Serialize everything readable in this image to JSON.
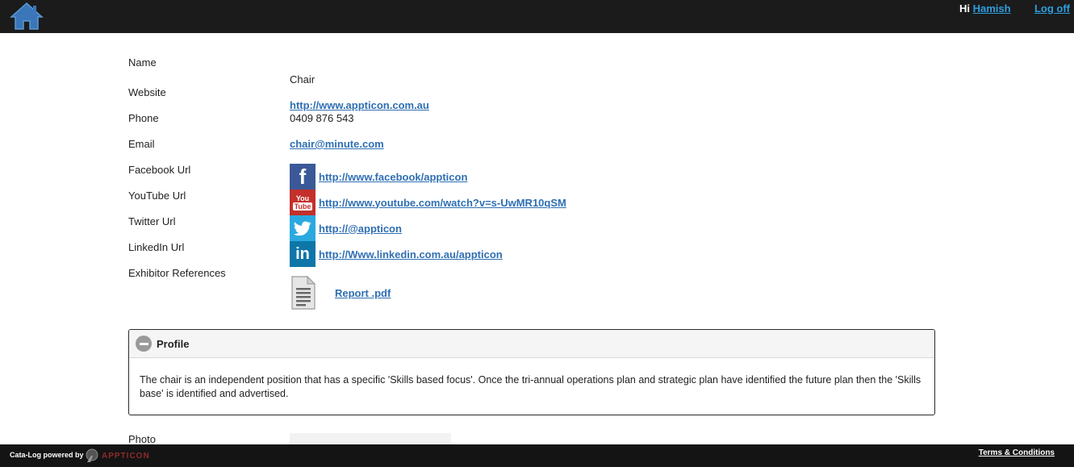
{
  "header": {
    "greeting": "Hi",
    "username": "Hamish",
    "logoff_label": "Log off"
  },
  "fields": {
    "name_label": "Name",
    "name_value": "Chair",
    "website_label": "Website",
    "website_value": "http://www.appticon.com.au",
    "phone_label": "Phone",
    "phone_value": "0409 876 543",
    "email_label": "Email",
    "email_value": "chair@minute.com",
    "facebook_label": "Facebook Url",
    "facebook_value": "http://www.facebook/appticon",
    "youtube_label": "YouTube Url",
    "youtube_value": "http://www.youtube.com/watch?v=s-UwMR10qSM",
    "twitter_label": "Twitter Url",
    "twitter_value": "http://@appticon",
    "linkedin_label": "LinkedIn Url",
    "linkedin_value": "http://Www.linkedin.com.au/appticon",
    "references_label": "Exhibitor References",
    "reference_file": "Report .pdf",
    "photo_label": "Photo"
  },
  "icons": {
    "facebook": "f",
    "youtube": "You Tube",
    "twitter": "twitter-bird-icon",
    "linkedin": "in"
  },
  "profile": {
    "title": "Profile",
    "text": "The chair is an independent position that has a specific 'Skills based focus'. Once the tri-annual operations plan and strategic plan have identified the future plan then the 'Skills base' is identified and advertised."
  },
  "footer": {
    "powered_by": "Cata-Log powered by",
    "brand": "APPTICON",
    "terms_label": "Terms & Conditions"
  },
  "colors": {
    "facebook": "#3b5998",
    "youtube": "#c4302b",
    "twitter": "#2aa9e0",
    "linkedin": "#0e76a8",
    "link": "#2f6fb3",
    "topbar": "#1b1b1b"
  }
}
